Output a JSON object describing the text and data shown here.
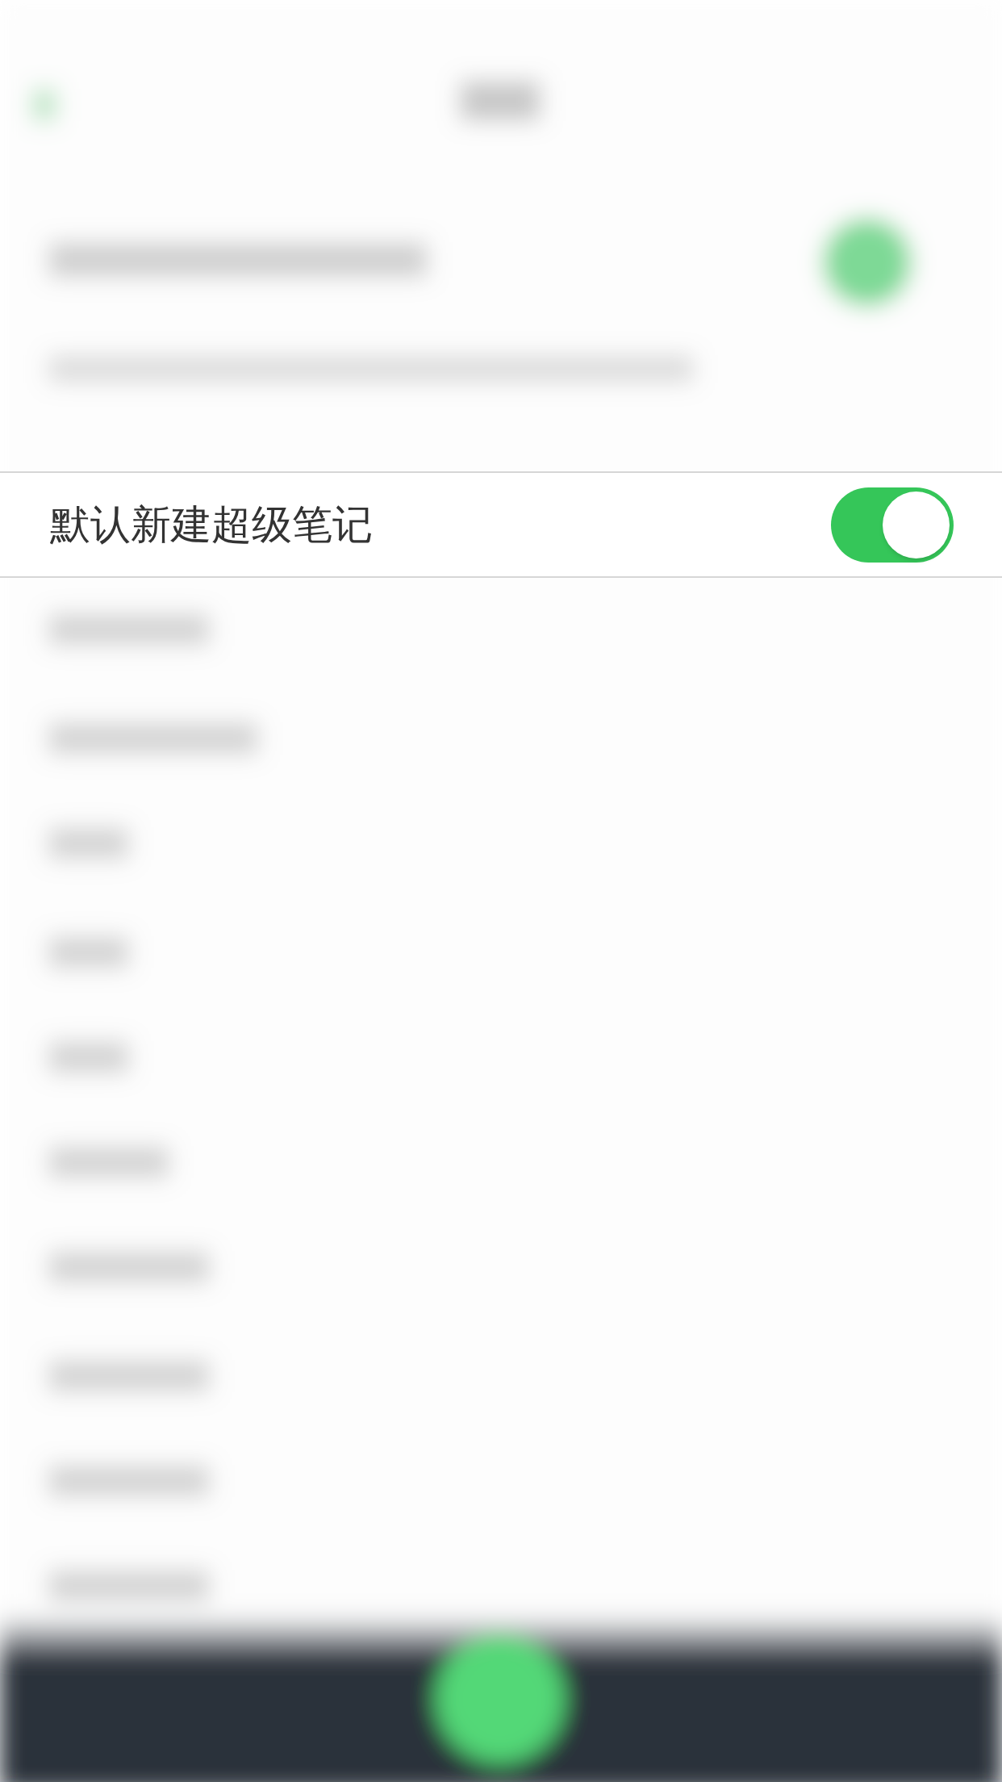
{
  "setting": {
    "label": "默认新建超级笔记",
    "on": true
  }
}
